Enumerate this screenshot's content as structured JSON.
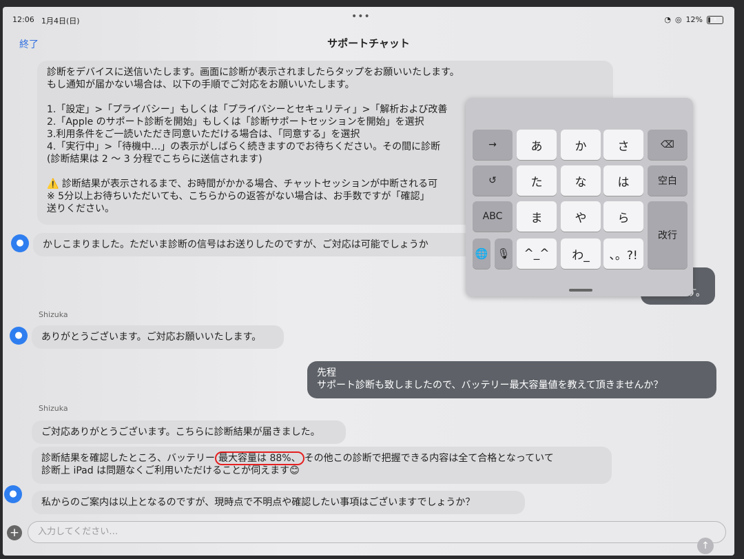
{
  "status": {
    "time": "12:06",
    "date": "1月4日(日)",
    "battery": "12%"
  },
  "nav": {
    "done": "終了",
    "title": "サポートチャット"
  },
  "messages": {
    "m1": "診断をデバイスに送信いたします。画面に診断が表示されましたらタップをお願いいたします。\nもし通知が届かない場合は、以下の手順でご対応をお願いいたします。\n\n1.「設定」>「プライバシー」もしくは「プライバシーとセキュリティ」>「解析および改善\n2.「Apple のサポート診断を開始」もしくは「診断サポートセッションを開始」を選択\n3.利用条件をご一読いただき同意いただける場合は、「同意する」を選択\n4.「実行中」>「待機中…」の表示がしばらく続きますのでお待ちください。その間に診断\n(診断結果は 2 〜 3 分程でこちらに送信されます)\n\n⚠️ 診断結果が表示されるまで、お時間がかかる場合、チャットセッションが中断される可\n※ 5分以上お待ちいただいても、こちらからの返答がない場合は、お手数ですが「確認」\n送りください。",
    "m2": "かしこまりました。ただいま診断の信号はお送りしたのですが、ご対応は可能でしょうか",
    "m3_tail": "す。",
    "sender1": "Shizuka",
    "m4": "ありがとうございます。ご対応お願いいたします。",
    "m5": "先程\nサポート診断も致しましたので、バッテリー最大容量値を教えて頂きませんか？",
    "sender2": "Shizuka",
    "m6": "ご対応ありがとうございます。こちらに診断結果が届きました。",
    "m7_a": "診断結果を確認したところ、バッテリー",
    "m7_b": "最大容量は 88%、",
    "m7_c": "その他この診断で把握できる内容は全て合格となっていて",
    "m7_d": "診断上 iPad は問題なくご利用いただけることが伺えます😊",
    "m8": "私からのご案内は以上となるのですが、現時点で不明点や確認したい事項はございますでしょうか？"
  },
  "keyboard": {
    "arrow": "→",
    "undo": "↺",
    "abc": "ABC",
    "globe": "🌐",
    "mic": "🎙",
    "a": "あ",
    "ka": "か",
    "sa": "さ",
    "ta": "た",
    "na": "な",
    "ha": "は",
    "ma": "ま",
    "ya": "や",
    "ra": "ら",
    "kao": "^_^",
    "wa": "わ_",
    "punct": "、。?!",
    "delete": "⌫",
    "space": "空白",
    "enter": "改行"
  },
  "input": {
    "placeholder": "入力してください…",
    "plus": "+",
    "send": "↑"
  }
}
